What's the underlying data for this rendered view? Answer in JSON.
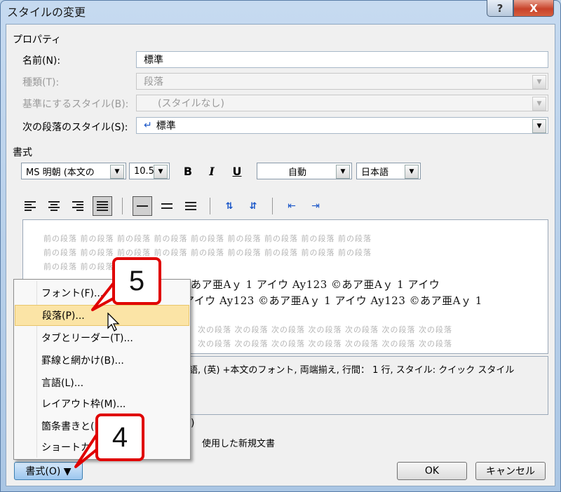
{
  "window": {
    "title": "スタイルの変更",
    "help_glyph": "?",
    "close_glyph": "X"
  },
  "properties": {
    "section_label": "プロパティ",
    "name": {
      "label": "名前(N):",
      "value": "標準"
    },
    "type": {
      "label": "種類(T):",
      "value": "段落"
    },
    "based_on": {
      "label": "基準にするスタイル(B):",
      "value": "(スタイルなし)"
    },
    "next_style": {
      "label": "次の段落のスタイル(S):",
      "value": "標準",
      "icon": "paragraph-return-icon"
    }
  },
  "format": {
    "section_label": "書式",
    "font": "MS 明朝 (本文の",
    "size": "10.5",
    "bold": "B",
    "italic": "I",
    "underline": "U",
    "color": "自動",
    "language": "日本語"
  },
  "preview": {
    "prev_line_1": "前の段落 前の段落 前の段落 前の段落 前の段落 前の段落 前の段落 前の段落 前の段落",
    "prev_line_2": "前の段落 前の段落 前の段落 前の段落 前の段落 前の段落 前の段落 前の段落 前の段落",
    "prev_line_3": "前の段落 前の段落",
    "sample_1": "あア亜Aｙ 1 アイウ Ay123 ©あア亜Aｙ 1 アイウ",
    "sample_2": "アイウ Ay123 ©あア亜Aｙ 1 アイウ Ay123 ©あア亜Aｙ 1",
    "next_line_1": "次の段落 次の段落 次の段落 次の段落 次の段落 次の段落 次の段落",
    "next_line_2": "次の段落 次の段落 次の段落 次の段落 次の段落 次の段落 次の段落"
  },
  "description": "語, (英) +本文のフォント, 両端揃え, 行間： 1 行, スタイル: クイック スタイル",
  "options": {
    "template_suffix": "使用した新規文書",
    "paren": ")"
  },
  "menu": {
    "items": [
      {
        "label": "フォント(F)..."
      },
      {
        "label": "段落(P)..."
      },
      {
        "label": "タブとリーダー(T)..."
      },
      {
        "label": "罫線と網かけ(B)..."
      },
      {
        "label": "言語(L)..."
      },
      {
        "label": "レイアウト枠(M)..."
      },
      {
        "label": "箇条書きと(N)..."
      },
      {
        "label": "ショートカ"
      }
    ],
    "highlighted_index": 1
  },
  "buttons": {
    "format": "書式(O) ▼",
    "ok": "OK",
    "cancel": "キャンセル"
  },
  "callouts": {
    "step_5": "5",
    "step_4": "4",
    "color": "#e00000"
  }
}
